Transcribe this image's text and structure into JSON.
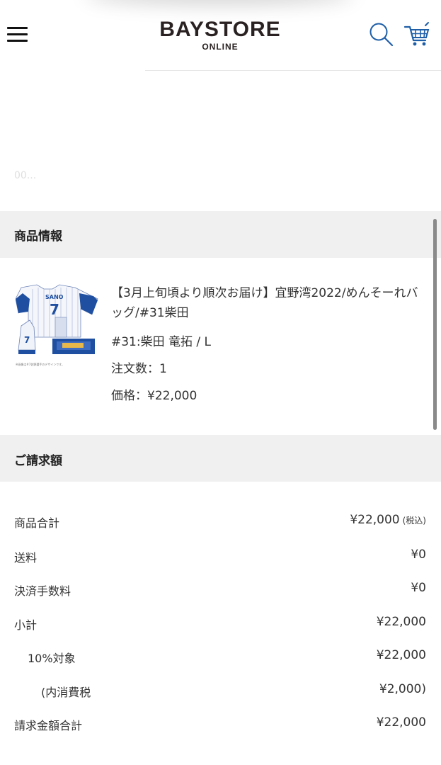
{
  "header": {
    "logo_main": "BAYSTORE",
    "logo_sub": "ONLINE"
  },
  "faded_text": "00...",
  "product_section": {
    "title": "商品情報",
    "product": {
      "title": "【3月上旬頃より順次お届け】宜野湾2022/めんそーれバッグ/#31柴田",
      "variant": "#31:柴田 竜拓 / L",
      "quantity": "注文数：1",
      "price": "価格：¥22,000"
    }
  },
  "billing_section": {
    "title": "ご請求額",
    "rows": [
      {
        "label": "商品合計",
        "value": "¥22,000",
        "note": "(税込)"
      },
      {
        "label": "送料",
        "value": "¥0"
      },
      {
        "label": "決済手数料",
        "value": "¥0"
      },
      {
        "label": "小計",
        "value": "¥22,000"
      },
      {
        "label": "10%対象",
        "value": "¥22,000"
      },
      {
        "label": "(内消費税",
        "value": "¥2,000)"
      },
      {
        "label": "請求金額合計",
        "value": "¥22,000"
      }
    ]
  },
  "colors": {
    "icon_blue": "#1f5fa8",
    "section_bg": "#f0f0f0",
    "logo": "#2a2222"
  },
  "icons": [
    "menu-icon",
    "search-icon",
    "cart-icon"
  ]
}
